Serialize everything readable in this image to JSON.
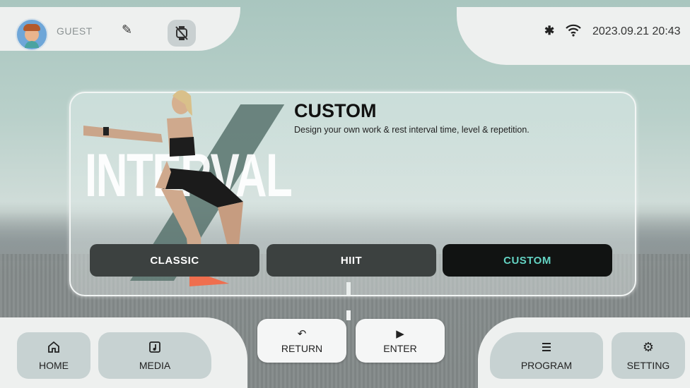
{
  "header": {
    "username": "GUEST",
    "datetime": "2023.09.21 20:43",
    "icons": [
      "avatar",
      "pencil-icon",
      "watch-off-icon",
      "bluetooth-icon",
      "wifi-icon"
    ]
  },
  "program_card": {
    "background_word": "INTERVAL",
    "title": "CUSTOM",
    "description": "Design your own work & rest interval time, level & repetition.",
    "modes": [
      {
        "label": "CLASSIC",
        "selected": false
      },
      {
        "label": "HIIT",
        "selected": false
      },
      {
        "label": "CUSTOM",
        "selected": true
      }
    ],
    "accent_color": "#63d2c2"
  },
  "footer": {
    "home_label": "HOME",
    "media_label": "MEDIA",
    "return_label": "RETURN",
    "enter_label": "ENTER",
    "program_label": "PROGRAM",
    "setting_label": "SETTING"
  }
}
